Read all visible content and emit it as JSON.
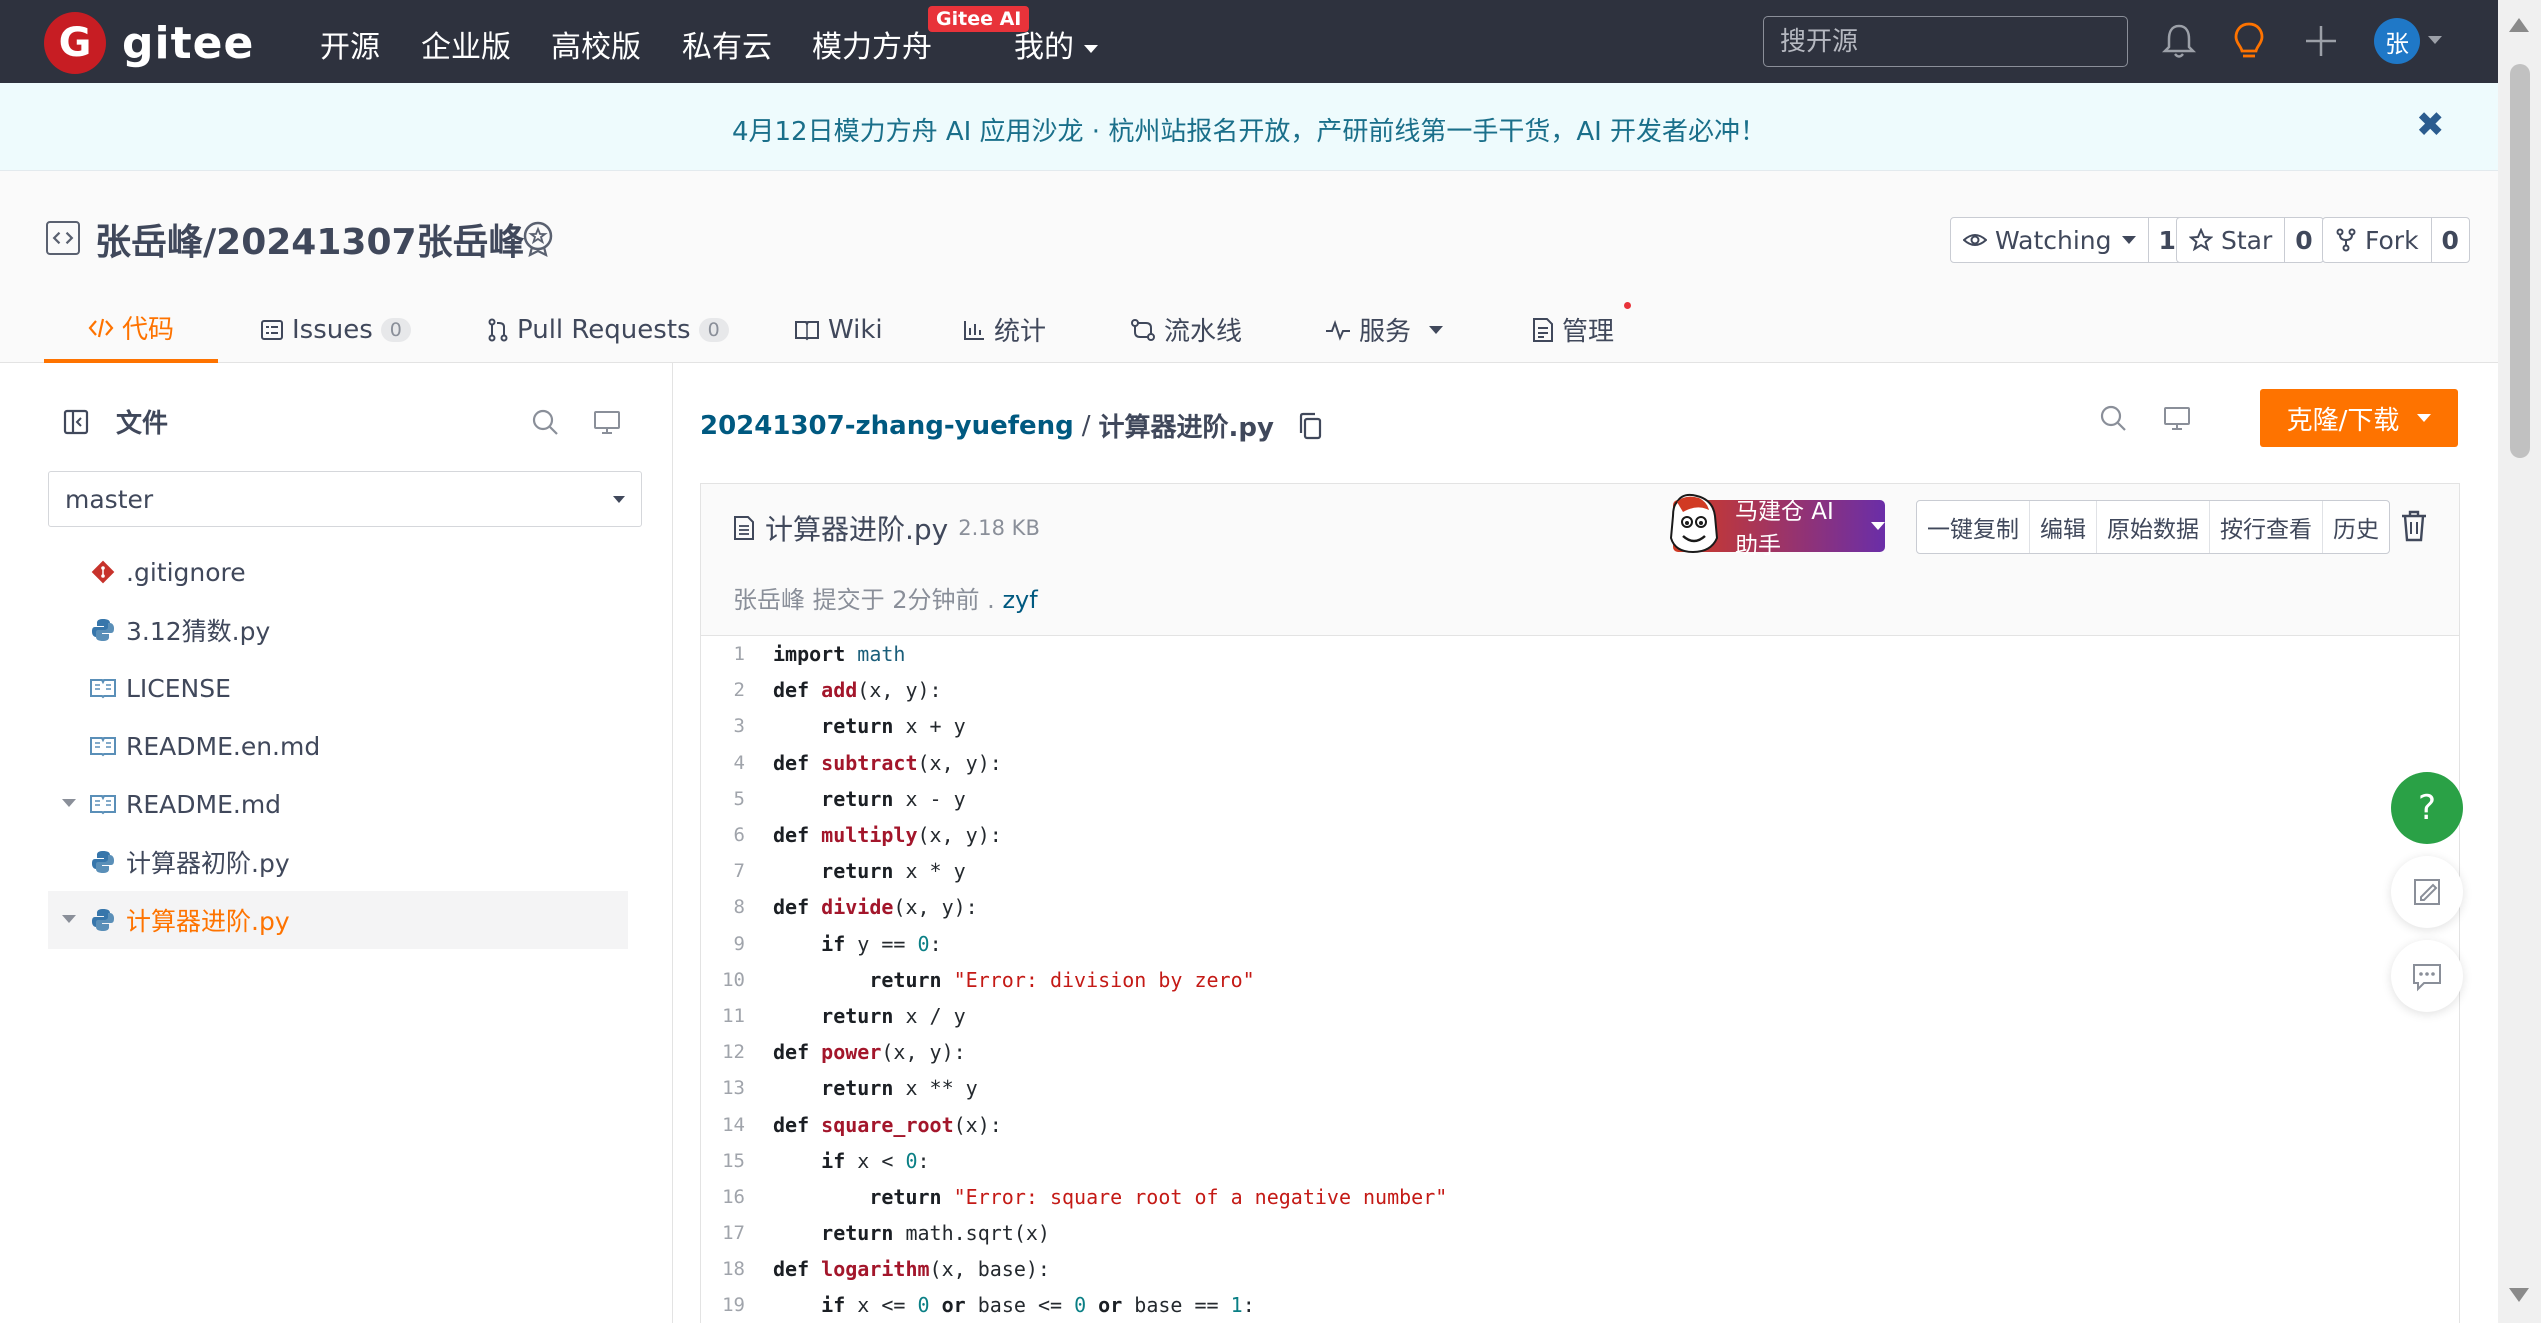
{
  "topnav": {
    "logo_text": "gitee",
    "items": [
      "开源",
      "企业版",
      "高校版",
      "私有云",
      "模力方舟",
      "我的"
    ],
    "ai_badge": "Gitee AI",
    "search_placeholder": "搜开源",
    "avatar_text": "张"
  },
  "banner": {
    "text": "4月12日模力方舟 AI 应用沙龙 · 杭州站报名开放，产研前线第一手干货，AI 开发者必冲！",
    "close": "✖"
  },
  "repo": {
    "title": "张岳峰/20241307张岳峰",
    "watch_label": "Watching",
    "watch_count": "1",
    "star_label": "Star",
    "star_count": "0",
    "fork_label": "Fork",
    "fork_count": "0"
  },
  "tabs": [
    {
      "label": "代码"
    },
    {
      "label": "Issues",
      "count": "0"
    },
    {
      "label": "Pull Requests",
      "count": "0"
    },
    {
      "label": "Wiki"
    },
    {
      "label": "统计"
    },
    {
      "label": "流水线"
    },
    {
      "label": "服务"
    },
    {
      "label": "管理"
    }
  ],
  "sidebar": {
    "title": "文件",
    "branch": "master",
    "files": [
      {
        "name": ".gitignore",
        "icon": "git-icon"
      },
      {
        "name": "3.12猜数.py",
        "icon": "python-icon"
      },
      {
        "name": "LICENSE",
        "icon": "book-icon"
      },
      {
        "name": "README.en.md",
        "icon": "book-icon"
      },
      {
        "name": "README.md",
        "icon": "book-icon"
      },
      {
        "name": "计算器初阶.py",
        "icon": "python-icon"
      },
      {
        "name": "计算器进阶.py",
        "icon": "python-icon"
      }
    ]
  },
  "main": {
    "breadcrumb_repo": "20241307-zhang-yuefeng",
    "breadcrumb_sep": "/",
    "breadcrumb_file": "计算器进阶.py",
    "clone_label": "克隆/下载",
    "file_name": "计算器进阶.py",
    "file_size": "2.18 KB",
    "ai_label": "马建仓 AI 助手",
    "actions": [
      "一键复制",
      "编辑",
      "原始数据",
      "按行查看",
      "历史"
    ],
    "commit_prefix": "张岳峰 提交于 2分钟前 .",
    "commit_author": "zyf"
  },
  "code": [
    "import math",
    "def add(x, y):",
    "    return x + y",
    "def subtract(x, y):",
    "    return x - y",
    "def multiply(x, y):",
    "    return x * y",
    "def divide(x, y):",
    "    if y == 0:",
    "        return \"Error: division by zero\"",
    "    return x / y",
    "def power(x, y):",
    "    return x ** y",
    "def square_root(x):",
    "    if x < 0:",
    "        return \"Error: square root of a negative number\"",
    "    return math.sqrt(x)",
    "def logarithm(x, base):",
    "    if x <= 0 or base <= 0 or base == 1:"
  ],
  "fab": {
    "help": "?"
  },
  "colors": {
    "accent": "#fe7300",
    "nav_bg": "#2e323e",
    "help_green": "#2aa146"
  }
}
